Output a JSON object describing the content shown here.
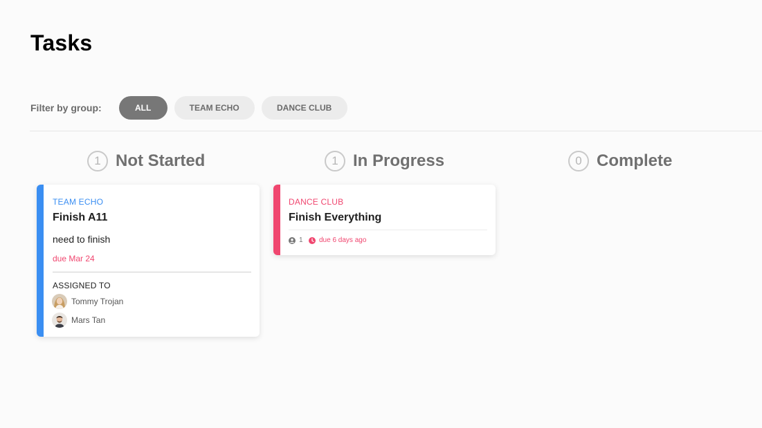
{
  "page": {
    "title": "Tasks"
  },
  "filter": {
    "label": "Filter by group:",
    "chips": [
      {
        "label": "ALL",
        "active": true
      },
      {
        "label": "TEAM ECHO",
        "active": false
      },
      {
        "label": "DANCE CLUB",
        "active": false
      }
    ]
  },
  "columns": [
    {
      "title": "Not Started",
      "count": "1"
    },
    {
      "title": "In Progress",
      "count": "1"
    },
    {
      "title": "Complete",
      "count": "0"
    }
  ],
  "cards": {
    "not_started": {
      "group": "TEAM ECHO",
      "group_color": "#3a8ef2",
      "title": "Finish A11",
      "description": "need to finish",
      "due": "due Mar 24",
      "assigned_label": "ASSIGNED TO",
      "assignees": [
        {
          "name": "Tommy Trojan",
          "avatar": "avatar-tommy"
        },
        {
          "name": "Mars Tan",
          "avatar": "avatar-mars"
        }
      ]
    },
    "in_progress": {
      "group": "DANCE CLUB",
      "group_color": "#f0466f",
      "title": "Finish Everything",
      "assignee_count": "1",
      "due": "due 6 days ago"
    }
  },
  "colors": {
    "accent_blue": "#3a8ef2",
    "accent_pink": "#f0466f",
    "chip_active": "#777777",
    "chip_inactive": "#ececec"
  }
}
